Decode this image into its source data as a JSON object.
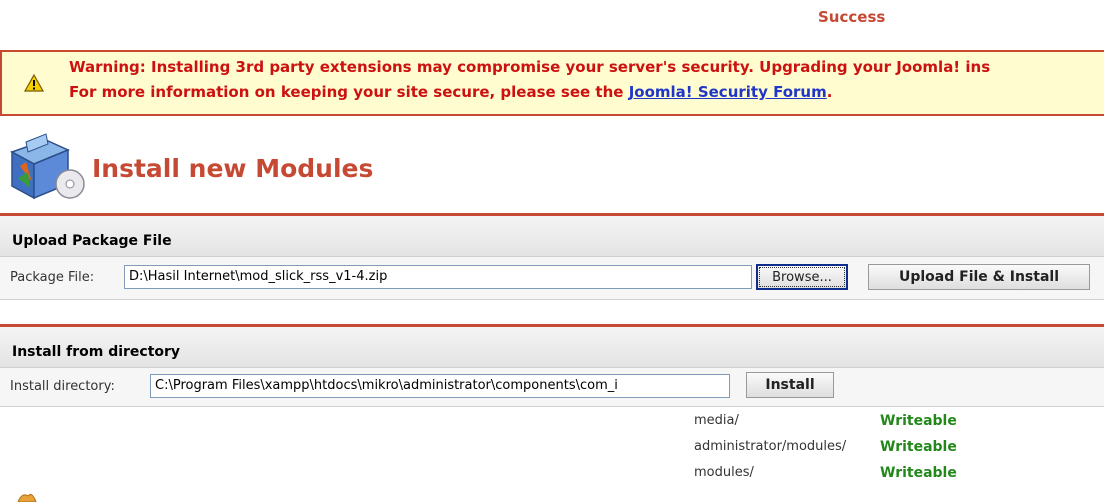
{
  "status": {
    "message": "Success"
  },
  "warning": {
    "line1": "Warning: Installing 3rd party extensions may compromise your server's security. Upgrading your Joomla! ins",
    "line2_prefix": "For more information on keeping your site secure, please see the ",
    "link_text": "Joomla! Security Forum",
    "line2_suffix": "."
  },
  "header": {
    "title": "Install new Modules"
  },
  "upload": {
    "title": "Upload Package File",
    "label": "Package File:",
    "value": "D:\\Hasil Internet\\mod_slick_rss_v1-4.zip",
    "browse_label": "Browse...",
    "submit_label": "Upload File & Install"
  },
  "directory": {
    "title": "Install from directory",
    "label": "Install directory:",
    "value": "C:\\Program Files\\xampp\\htdocs\\mikro\\administrator\\components\\com_i",
    "submit_label": "Install"
  },
  "permissions": [
    {
      "path": "media/",
      "status": "Writeable"
    },
    {
      "path": "administrator/modules/",
      "status": "Writeable"
    },
    {
      "path": "modules/",
      "status": "Writeable"
    }
  ],
  "colors": {
    "accent": "#c64934",
    "warning_text": "#cc1111",
    "ok": "#22881a",
    "link": "#1f36c7"
  }
}
